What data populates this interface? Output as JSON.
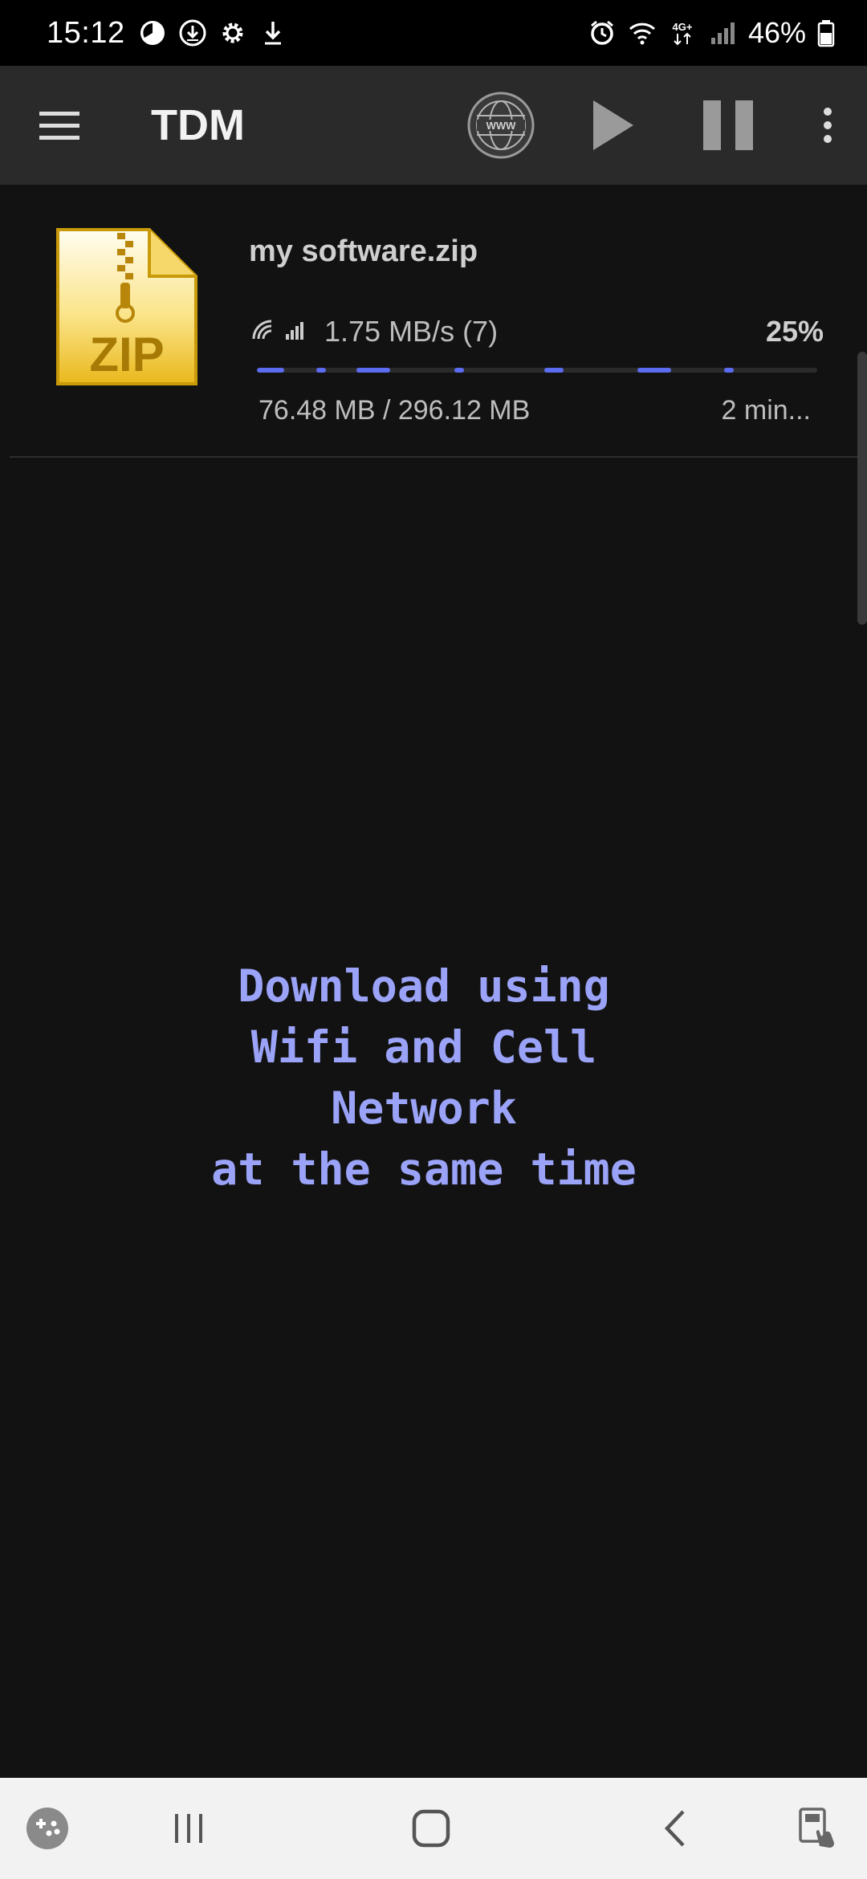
{
  "status_bar": {
    "time": "15:12",
    "battery_percent": "46%",
    "left_icons": [
      "pie-icon",
      "download-circle-icon",
      "gear-icon",
      "download-arrow-icon"
    ],
    "right_icons": [
      "alarm-icon",
      "wifi-icon",
      "4g-icon",
      "signal-icon",
      "battery-icon"
    ],
    "network_label": "4G+"
  },
  "toolbar": {
    "title": "TDM",
    "browser_label": "WWW"
  },
  "downloads": [
    {
      "file_name": "my software.zip",
      "icon_label": "ZIP",
      "speed": "1.75 MB/s (7)",
      "percent": "25%",
      "progress": 0.25,
      "size": "76.48 MB / 296.12 MB",
      "eta": "2 min..."
    }
  ],
  "promo": {
    "line1": "Download using",
    "line2": "Wifi and Cell",
    "line3": "Network",
    "line4": "at the same time"
  },
  "colors": {
    "accent": "#5c6cf0",
    "promo_text": "#9aa3f7",
    "toolbar_bg": "#2a2a2a",
    "background": "#121212"
  }
}
